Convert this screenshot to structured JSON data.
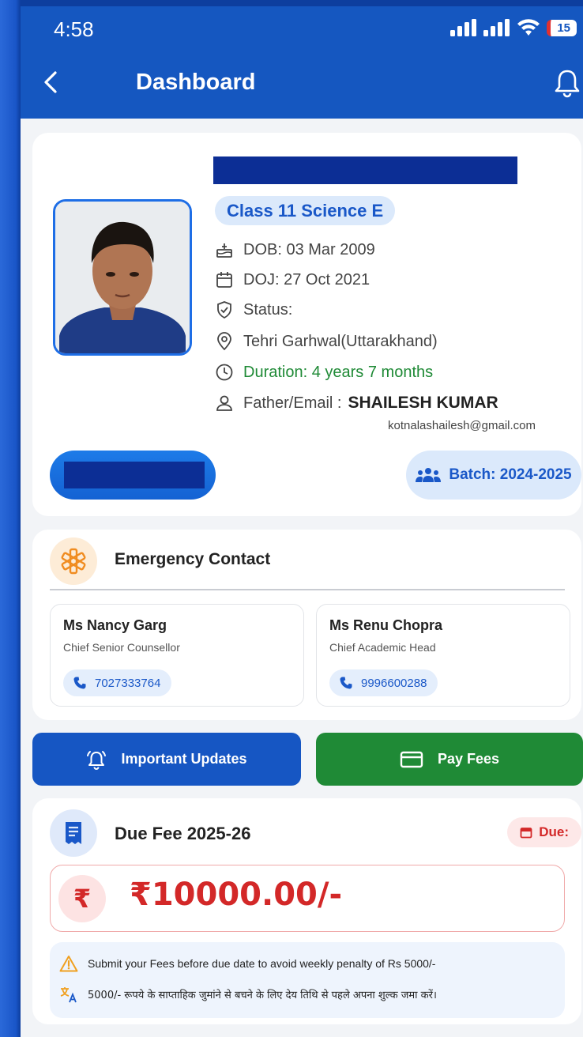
{
  "status_bar": {
    "time": "4:58",
    "battery": "15"
  },
  "header": {
    "title": "Dashboard"
  },
  "profile": {
    "class": "Class 11 Science E",
    "dob": "DOB: 03 Mar 2009",
    "doj": "DOJ: 27 Oct 2021",
    "status": "Status:",
    "location": "Tehri Garhwal(Uttarakhand)",
    "duration": "Duration: 4 years 7 months",
    "father_label": "Father/Email :",
    "father_name": "SHAILESH KUMAR",
    "email": "kotnalashailesh@gmail.com",
    "batch": "Batch: 2024-2025"
  },
  "emergency": {
    "title": "Emergency Contact",
    "contacts": [
      {
        "name": "Ms Nancy Garg",
        "role": "Chief Senior Counsellor",
        "phone": "7027333764"
      },
      {
        "name": "Ms Renu Chopra",
        "role": "Chief Academic Head",
        "phone": "9996600288"
      }
    ]
  },
  "actions": {
    "updates_label": "Important Updates",
    "fees_label": "Pay Fees"
  },
  "due_fee": {
    "title": "Due Fee 2025-26",
    "due_label": "Due:",
    "currency_symbol": "₹",
    "amount": "₹10000.00/-",
    "notice_en": "Submit your Fees before due date to avoid weekly penalty of Rs 5000/-",
    "notice_hi": "5000/- रूपये के साप्ताहिक जुमांने से बचने के लिए देय तिथि से पहले अपना शुल्क जमा करें।"
  },
  "colors": {
    "primary": "#1557c0",
    "green": "#1f8a36",
    "red": "#d32828",
    "redaction": "#0c2e95"
  }
}
